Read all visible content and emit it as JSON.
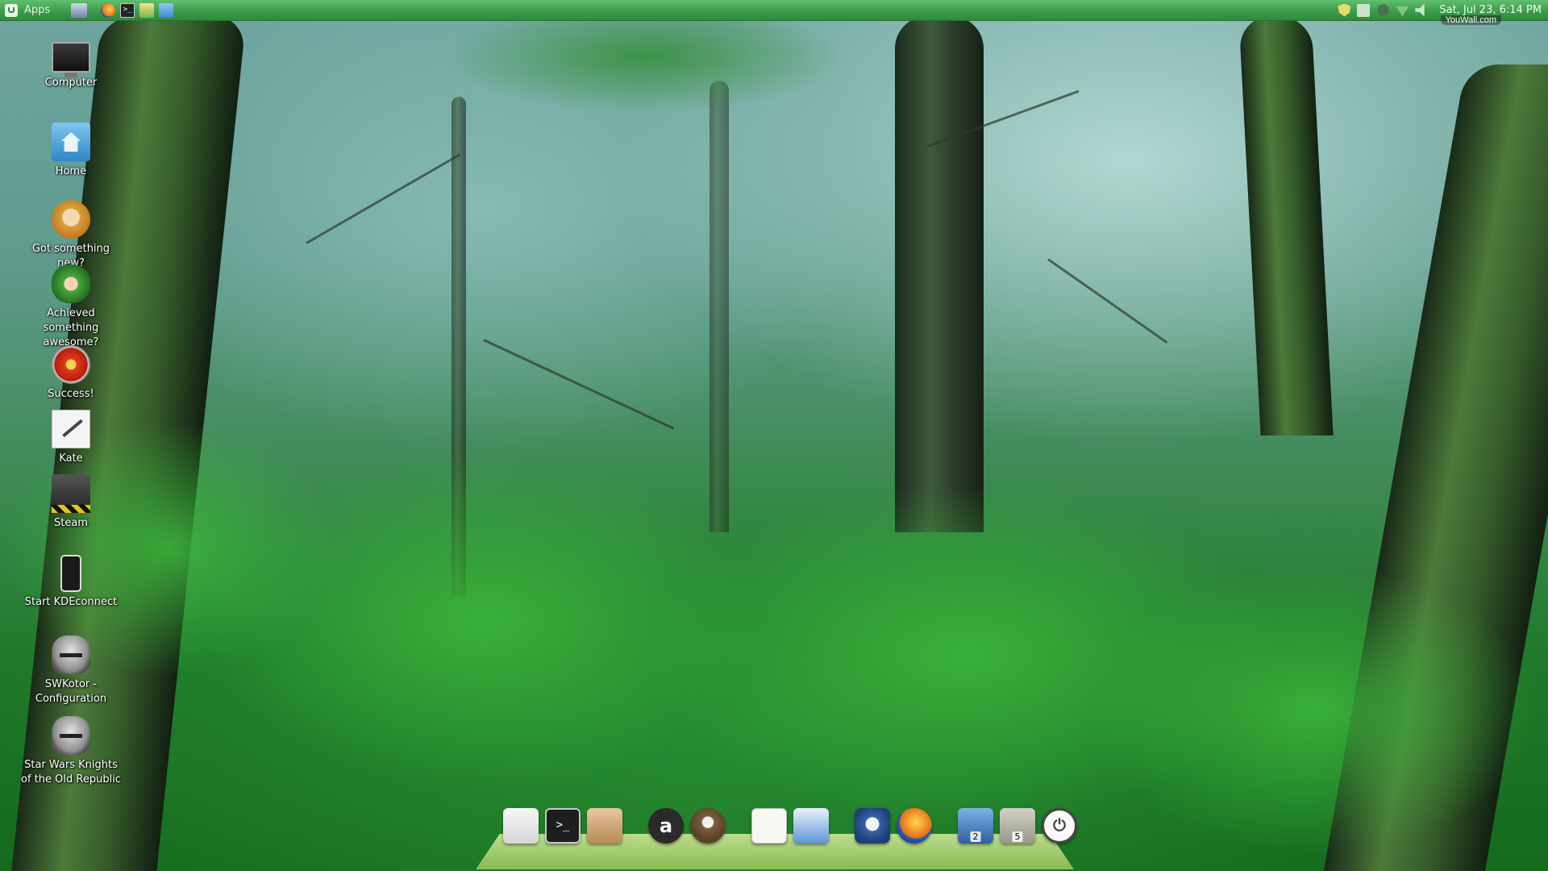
{
  "top_panel": {
    "menu_label": "Apps",
    "launchers": [
      "show-desktop",
      "firefox",
      "terminal",
      "text-editor",
      "files"
    ],
    "terminal_glyph": ">_",
    "tray": [
      "shield-icon",
      "network-card-icon",
      "user-icon",
      "wifi-icon",
      "volume-icon"
    ],
    "clock": "Sat, Jul 23,  6:14 PM"
  },
  "watermark": "YouWall.com",
  "desktop_icons": [
    {
      "label": "Computer",
      "icon": "computer-icon"
    },
    {
      "label": "Home",
      "icon": "home-folder-icon"
    },
    {
      "label": "Got something new?",
      "icon": "avatar-blonde-icon"
    },
    {
      "label": "Achieved something awesome?",
      "icon": "avatar-green-icon"
    },
    {
      "label": "Success!",
      "icon": "success-icon"
    },
    {
      "label": "Kate",
      "icon": "kate-icon"
    },
    {
      "label": "Steam",
      "icon": "steam-icon"
    },
    {
      "label": "Start KDEconnect",
      "icon": "kdeconnect-icon"
    },
    {
      "label": "SWKotor - Configuration",
      "icon": "swkotor-helmet-icon"
    },
    {
      "label": "Star Wars Knights of the Old Republic",
      "icon": "swkotor-helmet-icon"
    }
  ],
  "dock": {
    "items": [
      {
        "name": "system-monitor",
        "badge": ""
      },
      {
        "name": "terminal",
        "badge": "",
        "glyph": ">_"
      },
      {
        "name": "package-manager",
        "badge": ""
      },
      {
        "name": "amazon",
        "badge": "",
        "glyph": "a"
      },
      {
        "name": "gimp",
        "badge": ""
      },
      {
        "name": "text-editor",
        "badge": ""
      },
      {
        "name": "writer",
        "badge": ""
      },
      {
        "name": "thunderbird",
        "badge": ""
      },
      {
        "name": "firefox",
        "badge": ""
      },
      {
        "name": "window-group",
        "badge": "2"
      },
      {
        "name": "archive",
        "badge": "5"
      },
      {
        "name": "shutdown",
        "badge": "",
        "glyph": "⏻"
      }
    ]
  }
}
